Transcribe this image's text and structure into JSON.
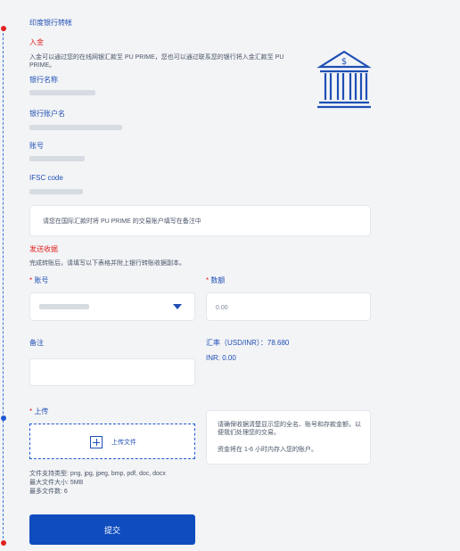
{
  "title": "印度银行转帐",
  "deposit": {
    "heading": "入金",
    "desc": "入金可以通过您的在线网银汇款至 PU PRIME，您也可以通过联系您的银行将入金汇款至 PU PRIME。",
    "bank_name_label": "银行名称",
    "account_name_label": "银行账户名",
    "account_no_label": "账号",
    "ifsc_label": "IFSC code",
    "notice": "请您在国际汇款时将 PU PRIME 的交易账户填写在备注中"
  },
  "receipt": {
    "heading": "发送收据",
    "desc": "完成转账后，请填写以下表格并附上银行转账收据副本。",
    "account_label": "账号",
    "amount_label": "数额",
    "amount_placeholder": "0.00",
    "remark_label": "备注",
    "rate_text": "汇率（USD/INR）：78.680",
    "inr_text": "INR: 0.00",
    "upload_label": "上传",
    "upload_button": "上传文件",
    "file_types": "文件支持类型: png, jpg, jpeg, bmp, pdf, doc, docx",
    "max_size": "最大文件大小: 5MB",
    "max_count": "最多文件数: 6",
    "info_line1": "请确保收据清楚显示您的全名、账号和存款金额，以便我们处理您的交易。",
    "info_line2": "资金将在 1-6 小时内存入您的账户。",
    "submit": "提交"
  },
  "required_mark": "*",
  "colors": {
    "accent": "#0f4dbf",
    "required": "#e02020"
  },
  "icons": {
    "bank": "bank-building-icon"
  }
}
